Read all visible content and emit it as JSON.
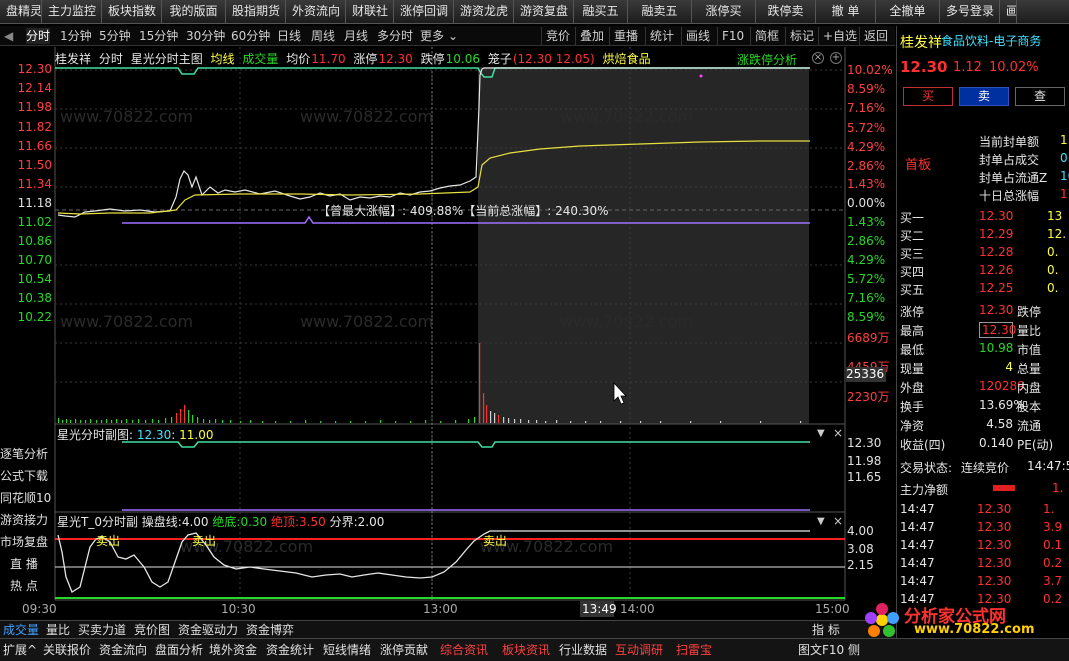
{
  "top_menu": [
    "盘精灵",
    "主力监控",
    "板块指数",
    "我的版面",
    "股指期货",
    "外资流向",
    "财联社",
    "涨停回调",
    "游资龙虎",
    "游资复盘",
    "融买五",
    "融卖五",
    "涨停买",
    "跌停卖",
    "撤 单",
    "全撤单",
    "多号登录",
    "画"
  ],
  "period_tabs": [
    "分时",
    "1分钟",
    "5分钟",
    "15分钟",
    "30分钟",
    "60分钟",
    "日线",
    "周线",
    "月线",
    "多分时",
    "更多"
  ],
  "right_tabs": [
    "竞价",
    "叠加",
    "重播",
    "统计",
    "画线",
    "F10",
    "简框",
    "标记",
    "+自选",
    "返回"
  ],
  "main_header": {
    "stock": "桂发祥",
    "mode": "分时",
    "indicator": "星光分时主图",
    "avg_label": "均线",
    "vol_label": "成交量",
    "avg_price_label": "均价",
    "avg_price": "11.70",
    "limit_up_label": "涨停",
    "limit_up": "12.30",
    "limit_down_label": "跌停",
    "limit_down": "10.06",
    "cage_label": "笼子",
    "cage_value": "(12.30 12.05)",
    "sector": "烘焙食品",
    "right_label": "涨跌停分析"
  },
  "price_axis_left": [
    "12.30",
    "12.14",
    "11.98",
    "11.82",
    "11.66",
    "11.50",
    "11.34",
    "11.18",
    "11.02",
    "10.86",
    "10.70",
    "10.54",
    "10.38",
    "10.22"
  ],
  "pct_axis_right": [
    "10.02%",
    "8.59%",
    "7.16%",
    "5.72%",
    "4.29%",
    "2.86%",
    "1.43%",
    "0.00%",
    "1.43%",
    "2.86%",
    "4.29%",
    "5.72%",
    "7.16%",
    "8.59%"
  ],
  "volume_axis_right": [
    "6689万",
    "4459万",
    "2230万"
  ],
  "cursor_value": "25336",
  "annotation": "【曾最大涨幅】: 409.88%【当前总涨幅】: 240.30%",
  "sub1": {
    "title": "星光分时副图",
    "value": "12.30",
    "value2": "11.00",
    "axis": [
      "12.30",
      "11.98",
      "11.65"
    ]
  },
  "sub2": {
    "title": "星光T_0分时副",
    "line_label": "操盘线:",
    "line_value": "4.00",
    "bottom_label": "绝底:",
    "bottom_value": "0.30",
    "top_label": "绝顶:",
    "top_value": "3.50",
    "boundary_label": "分界:",
    "boundary_value": "2.00",
    "axis": [
      "4.00",
      "3.08",
      "2.15"
    ],
    "sell_signals": [
      "卖出",
      "卖出",
      "卖出"
    ]
  },
  "time_axis": [
    "09:30",
    "10:30",
    "13:00",
    "13:49",
    "14:00",
    "15:00"
  ],
  "left_nav": [
    "逐笔分析",
    "公式下载",
    "同花顺10",
    "游资接力",
    "市场复盘",
    "直  播",
    "热  点"
  ],
  "bottom_tabs": [
    "成交量",
    "量比",
    "买卖力道",
    "竞价图",
    "资金驱动力",
    "资金博弈"
  ],
  "bottom_tab_right": "指 标",
  "bottom_bar": [
    "扩展^",
    "关联报价",
    "资金流向",
    "盘面分析",
    "境外资金",
    "资金统计",
    "短线情绪",
    "涨停贡献",
    "综合资讯",
    "板块资讯",
    "行业数据",
    "互动调研",
    "扫雷宝"
  ],
  "bottom_bar_right": [
    "图文F10",
    "侧"
  ],
  "right_panel": {
    "name": "桂发祥",
    "sector": "食品饮料-电子商务",
    "price": "12.30",
    "change": "1.12",
    "pct": "10.02%",
    "buy_btn": "买",
    "sell_btn": "卖",
    "query_btn": "查",
    "first_board": "首板",
    "seal_rows": [
      {
        "label": "当前封单额",
        "value": "1.6"
      },
      {
        "label": "封单占成交",
        "value": "0.4"
      },
      {
        "label": "封单占流通Z",
        "value": "10"
      },
      {
        "label": "十日总涨幅",
        "value": "17."
      }
    ],
    "bids": [
      {
        "label": "买一",
        "price": "12.30",
        "vol": "13"
      },
      {
        "label": "买二",
        "price": "12.29",
        "vol": "12."
      },
      {
        "label": "买三",
        "price": "12.28",
        "vol": "0."
      },
      {
        "label": "买四",
        "price": "12.26",
        "vol": "0."
      },
      {
        "label": "买五",
        "price": "12.25",
        "vol": "0."
      }
    ],
    "stats": [
      {
        "l1": "涨停",
        "v1": "12.30",
        "l2": "跌停"
      },
      {
        "l1": "最高",
        "v1": "12.30",
        "l2": "量比"
      },
      {
        "l1": "最低",
        "v1": "10.98",
        "l2": "市值"
      },
      {
        "l1": "现量",
        "v1": "4",
        "l2": "总量"
      },
      {
        "l1": "外盘",
        "v1": "120289",
        "l2": "内盘"
      },
      {
        "l1": "换手",
        "v1": "13.69%",
        "l2": "股本"
      },
      {
        "l1": "净资",
        "v1": "4.58",
        "l2": "流通"
      },
      {
        "l1": "收益(四)",
        "v1": "0.140",
        "l2": "PE(动)"
      }
    ],
    "trade_status_label": "交易状态:",
    "trade_status": "连续竞价",
    "trade_time": "14:47:5",
    "net_label": "主力净额",
    "net_value": "1.",
    "ticks": [
      {
        "t": "14:47",
        "p": "12.30",
        "v": "1."
      },
      {
        "t": "14:47",
        "p": "12.30",
        "v": "3.9"
      },
      {
        "t": "14:47",
        "p": "12.30",
        "v": "0.1"
      },
      {
        "t": "14:47",
        "p": "12.30",
        "v": "0.2"
      },
      {
        "t": "14:47",
        "p": "12.30",
        "v": "3.7"
      },
      {
        "t": "14:47",
        "p": "12.30",
        "v": "0.2"
      }
    ]
  },
  "watermark_logo": "分析家公式网",
  "watermark_url": "www.70822.com"
}
